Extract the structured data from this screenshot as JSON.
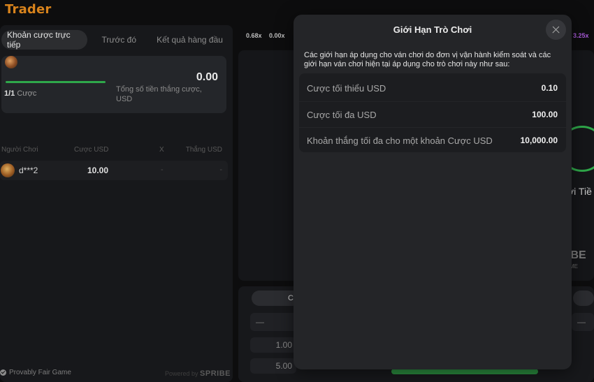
{
  "app": {
    "title": "Trader"
  },
  "tabs": [
    {
      "label": "Khoản cược trực tiếp",
      "active": true
    },
    {
      "label": "Trước đó",
      "active": false
    },
    {
      "label": "Kết quả hàng đầu",
      "active": false
    }
  ],
  "summary": {
    "bet_count": "1/1",
    "bet_label": "Cược",
    "total_win_value": "0.00",
    "total_win_label": "Tổng số tiền thắng cược, USD",
    "progress": 1.0
  },
  "bets_table": {
    "headers": [
      "Người Chơi",
      "Cược USD",
      "X",
      "Thắng USD"
    ],
    "rows": [
      {
        "player": "d***2",
        "bet": "10.00",
        "multiplier": "-",
        "win": "-"
      }
    ]
  },
  "footer": {
    "provably_fair": "Provably Fair Game",
    "powered_by": "Powered by",
    "brand": "SPRIBE"
  },
  "history": [
    "0.68x",
    "0.00x",
    "3.25x"
  ],
  "background": {
    "ghost_text_1": "ơi Tiề",
    "ghost_text_2": "IBE",
    "ghost_text_3": "ME",
    "bet_pill_text": "C",
    "field_left": "—",
    "field_right": "—",
    "quick_1": "1.00",
    "quick_2": "5.00"
  },
  "modal": {
    "title": "Giới Hạn Trò Chơi",
    "description": "Các giới hạn áp dụng cho ván chơi do đơn vị vận hành kiểm soát và các giới hạn ván chơi hiện tại áp dụng cho trò chơi này như sau:",
    "limits": [
      {
        "label": "Cược tối thiểu USD",
        "value": "0.10"
      },
      {
        "label": "Cược tối đa USD",
        "value": "100.00"
      },
      {
        "label": "Khoản thắng tối đa cho một khoản Cược USD",
        "value": "10,000.00"
      }
    ]
  },
  "colors": {
    "brand": "#d8831c",
    "accent_green": "#2fa84a",
    "modal_bg": "#242528",
    "history_purple": "#a85ad8"
  },
  "icons": [
    "close-icon",
    "check-circle-icon",
    "avatar-icon"
  ]
}
